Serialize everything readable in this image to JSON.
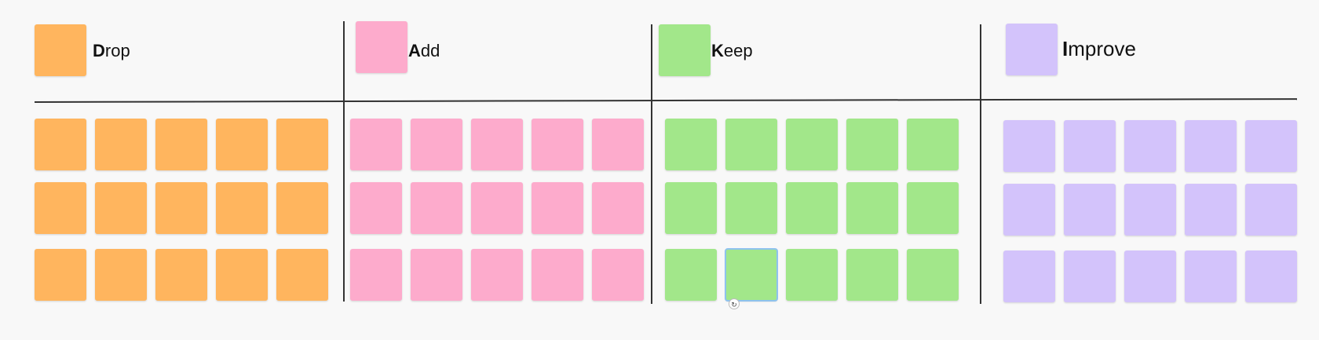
{
  "columns": [
    {
      "key": "drop",
      "initial": "D",
      "rest": "rop",
      "color": "#ffb55e",
      "rows": 3,
      "cols": 5
    },
    {
      "key": "add",
      "initial": "A",
      "rest": "dd",
      "color": "#fdabcc",
      "rows": 3,
      "cols": 5
    },
    {
      "key": "keep",
      "initial": "K",
      "rest": "eep",
      "color": "#a2e78a",
      "rows": 3,
      "cols": 5
    },
    {
      "key": "improve",
      "initial": "I",
      "rest": "mprove",
      "color": "#d3c3fb",
      "rows": 3,
      "cols": 5
    }
  ],
  "selected_note": {
    "column": "keep",
    "row": 2,
    "col": 1
  },
  "icons": {
    "resize_handle": "rotate-handle-icon"
  },
  "selection_color": "#8ec2ee",
  "divider_color": "#333333"
}
